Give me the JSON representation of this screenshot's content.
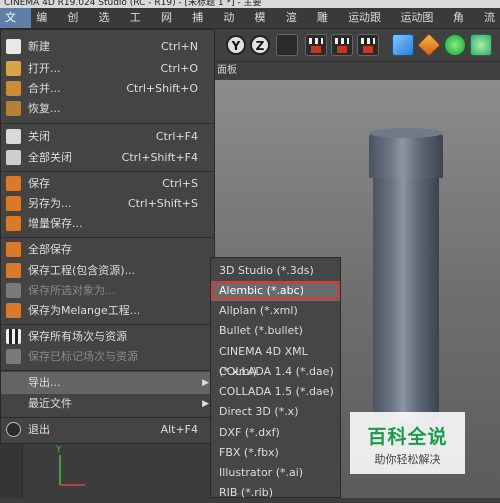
{
  "window": {
    "title": "CINEMA 4D R19.024 Studio (RC - R19) - [未标题 1 *] - 主要"
  },
  "menubar": [
    "文件",
    "编辑",
    "创建",
    "选择",
    "工具",
    "网格",
    "捕捉",
    "动画",
    "模拟",
    "渲染",
    "雕刻",
    "运动跟踪",
    "运动图形",
    "角色",
    "流"
  ],
  "toolbar": {
    "axes": [
      "Y",
      "Z"
    ]
  },
  "viewport": {
    "header": "面板"
  },
  "file_menu": {
    "items": [
      {
        "label": "新建",
        "shortcut": "Ctrl+N",
        "icon": "new-file-icon"
      },
      {
        "label": "打开...",
        "shortcut": "Ctrl+O",
        "icon": "open-folder-icon"
      },
      {
        "label": "合并...",
        "shortcut": "Ctrl+Shift+O",
        "icon": "merge-icon"
      },
      {
        "label": "恢复...",
        "shortcut": "",
        "icon": "revert-icon"
      },
      {
        "label": "关闭",
        "shortcut": "Ctrl+F4",
        "icon": "close-file-icon"
      },
      {
        "label": "全部关闭",
        "shortcut": "Ctrl+Shift+F4",
        "icon": "close-all-icon"
      },
      {
        "label": "保存",
        "shortcut": "Ctrl+S",
        "icon": "save-icon"
      },
      {
        "label": "另存为...",
        "shortcut": "Ctrl+Shift+S",
        "icon": "save-as-icon"
      },
      {
        "label": "增量保存...",
        "shortcut": "",
        "icon": "incremental-save-icon"
      },
      {
        "label": "全部保存",
        "shortcut": "",
        "icon": "save-all-icon"
      },
      {
        "label": "保存工程(包含资源)...",
        "shortcut": "",
        "icon": "save-project-icon"
      },
      {
        "label": "保存所选对象为...",
        "shortcut": "",
        "icon": "save-selected-icon"
      },
      {
        "label": "保存为Melange工程...",
        "shortcut": "",
        "icon": "melange-icon"
      },
      {
        "label": "保存所有场次与资源",
        "shortcut": "",
        "icon": "save-takes-icon"
      },
      {
        "label": "保存已标记场次与资源",
        "shortcut": "",
        "icon": "save-marked-takes-icon"
      },
      {
        "label": "导出...",
        "shortcut": "",
        "icon": ""
      },
      {
        "label": "最近文件",
        "shortcut": "",
        "icon": ""
      },
      {
        "label": "退出",
        "shortcut": "Alt+F4",
        "icon": "power-icon"
      }
    ]
  },
  "export_submenu": {
    "items": [
      "3D Studio (*.3ds)",
      "Alembic (*.abc)",
      "Allplan (*.xml)",
      "Bullet (*.bullet)",
      "CINEMA 4D XML (*.xml)",
      "COLLADA 1.4 (*.dae)",
      "COLLADA 1.5 (*.dae)",
      "Direct 3D (*.x)",
      "DXF (*.dxf)",
      "FBX (*.fbx)",
      "Illustrator (*.ai)",
      "RIB (*.rib)"
    ],
    "selected": "Alembic (*.abc)"
  },
  "watermark": {
    "title": "百科全说",
    "subtitle": "助你轻松解决"
  },
  "colors": {
    "menu_bg": "#444444",
    "highlight": "#646464",
    "selection_outline": "#d23b3b",
    "watermark_green": "#1a9a4e"
  }
}
